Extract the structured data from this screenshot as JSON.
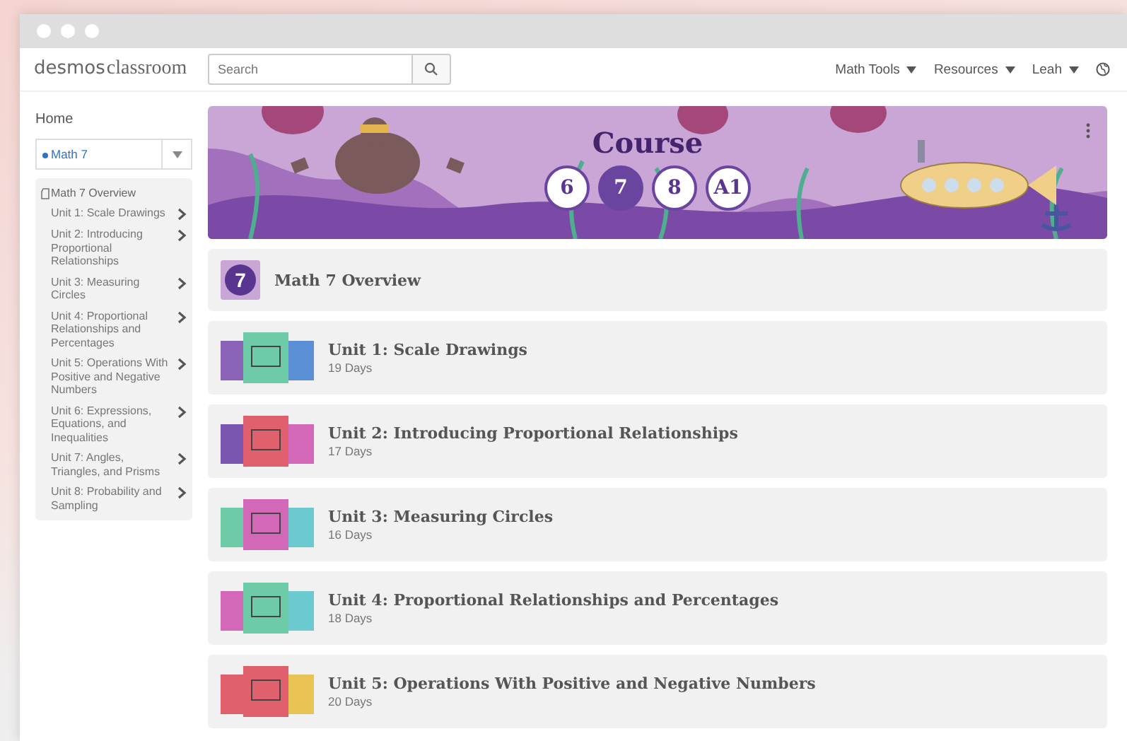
{
  "header": {
    "logo_bold": "desmos",
    "logo_light": "classroom",
    "search": {
      "placeholder": "Search"
    },
    "menus": [
      "Math Tools",
      "Resources",
      "Leah"
    ]
  },
  "sidebar": {
    "home": "Home",
    "course_select": "Math 7",
    "overview": "Math 7 Overview",
    "units": [
      {
        "label": "Unit 1: Scale Drawings",
        "expanded": false
      },
      {
        "label": "Unit 2: Introducing Proportional Relationships",
        "expanded": false
      },
      {
        "label": "Unit 3: Measuring Circles",
        "expanded": false
      },
      {
        "label": "Unit 4: Proportional Relationships and Percentages",
        "expanded": false
      },
      {
        "label": "Unit 5: Operations With Positive and Negative Numbers",
        "expanded": false
      },
      {
        "label": "Unit 6: Expressions, Equations, and Inequalities",
        "expanded": false
      },
      {
        "label": "Unit 7: Angles, Triangles, and Prisms",
        "expanded": false
      },
      {
        "label": "Unit 8: Probability and Sampling",
        "expanded": false
      }
    ]
  },
  "banner": {
    "title": "Course",
    "grades": [
      {
        "label": "6",
        "selected": false
      },
      {
        "label": "7",
        "selected": true
      },
      {
        "label": "8",
        "selected": false
      },
      {
        "label": "A1",
        "selected": false
      }
    ]
  },
  "overview_card": {
    "badge": "7",
    "title": "Math 7 Overview"
  },
  "unit_cards": [
    {
      "title": "Unit 1: Scale Drawings",
      "days": "19 Days"
    },
    {
      "title": "Unit 2: Introducing Proportional Relationships",
      "days": "17 Days"
    },
    {
      "title": "Unit 3: Measuring Circles",
      "days": "16 Days"
    },
    {
      "title": "Unit 4: Proportional Relationships and Percentages",
      "days": "18 Days"
    },
    {
      "title": "Unit 5: Operations With Positive and Negative Numbers",
      "days": "20 Days"
    }
  ]
}
